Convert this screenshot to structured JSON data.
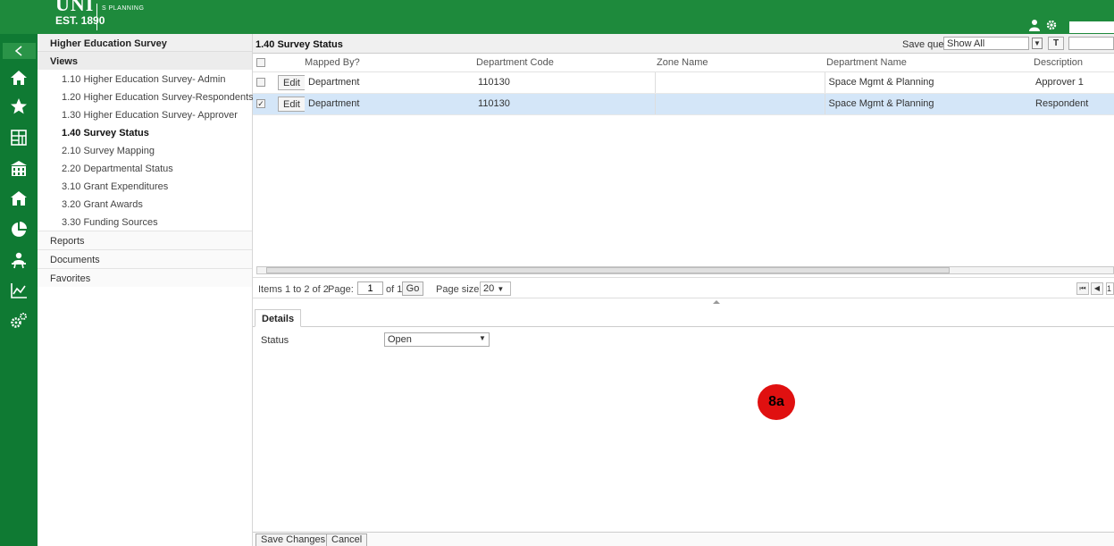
{
  "header": {
    "logo_text": "UNI",
    "established": "EST. 1890",
    "subtitle": "S PLANNING",
    "icons": [
      "user-icon",
      "gear-icon"
    ]
  },
  "rail": {
    "back_icon": "chevron-left-icon",
    "icons": [
      "home-icon",
      "star-icon",
      "building-grid-icon",
      "campus-building-icon",
      "house-icon",
      "pie-chart-icon",
      "person-desk-icon",
      "line-chart-icon",
      "gears-icon"
    ]
  },
  "nav": {
    "header": "Higher Education Survey",
    "views_label": "Views",
    "items": [
      "1.10 Higher Education Survey- Admin",
      "1.20 Higher Education Survey-Respondents",
      "1.30 Higher Education Survey- Approver",
      "1.40 Survey Status",
      "2.10 Survey Mapping",
      "2.20 Departmental Status",
      "3.10 Grant Expenditures",
      "3.20 Grant Awards",
      "3.30 Funding Sources"
    ],
    "active_index": 3,
    "sections": [
      "Reports",
      "Documents",
      "Favorites"
    ]
  },
  "grid": {
    "title": "1.40 Survey Status",
    "save_query_label": "Save query",
    "save_query_value": "Show All",
    "filter_label": "T",
    "columns": [
      "Mapped By?",
      "Department Code",
      "Zone Name",
      "Department Name",
      "Description"
    ],
    "edit_label": "Edit",
    "rows": [
      {
        "checked": false,
        "mapped_by": "Department",
        "dept_code": "110130",
        "zone": "",
        "dept_name": "Space Mgmt & Planning",
        "description": "Approver 1"
      },
      {
        "checked": true,
        "mapped_by": "Department",
        "dept_code": "110130",
        "zone": "",
        "dept_name": "Space Mgmt & Planning",
        "description": "Respondent"
      }
    ]
  },
  "pager": {
    "items_text": "Items 1 to 2 of 2",
    "page_label": "Page:",
    "page_value": "1",
    "of_text": "of 1",
    "go_label": "Go",
    "page_size_label": "Page size:",
    "page_size_value": "20",
    "last_page_num": "1"
  },
  "details": {
    "tab_label": "Details",
    "status_label": "Status",
    "status_value": "Open"
  },
  "annotation": {
    "badge_text": "8a",
    "badge_color": "#e01010"
  },
  "footer": {
    "save_label": "Save Changes",
    "cancel_label": "Cancel"
  },
  "colors": {
    "brand_green": "#1e8a3c",
    "rail_green": "#0f7a33",
    "selected_row": "#d4e6f8"
  }
}
